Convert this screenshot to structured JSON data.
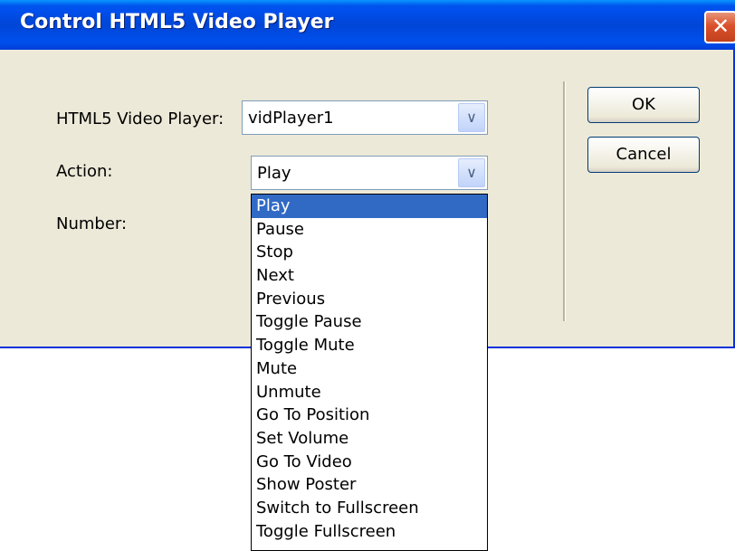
{
  "dialog": {
    "title": "Control HTML5 Video Player",
    "close_glyph": "✕"
  },
  "form": {
    "player_label": "HTML5 Video Player:",
    "player_value": "vidPlayer1",
    "action_label": "Action:",
    "action_value": "Play",
    "number_label": "Number:"
  },
  "buttons": {
    "ok": "OK",
    "cancel": "Cancel"
  },
  "dropdown": {
    "selected_index": 0,
    "options": [
      "Play",
      "Pause",
      "Stop",
      "Next",
      "Previous",
      "Toggle Pause",
      "Toggle Mute",
      "Mute",
      "Unmute",
      "Go To Position",
      "Set Volume",
      "Go To Video",
      "Show Poster",
      "Switch to Fullscreen",
      "Toggle Fullscreen"
    ]
  },
  "icons": {
    "dropdown_arrow": "chevron-down-icon",
    "close": "close-icon"
  },
  "colors": {
    "titlebar": "#0050ee",
    "selection": "#316ac5",
    "dialog_bg": "#ece9d8"
  }
}
